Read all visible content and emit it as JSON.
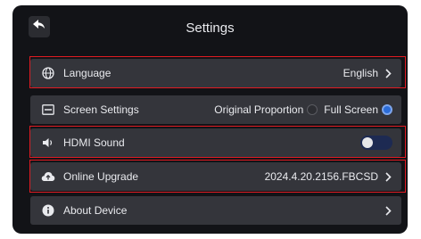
{
  "header": {
    "title": "Settings"
  },
  "rows": [
    {
      "label": "Language",
      "value": "English"
    },
    {
      "label": "Screen Settings",
      "option_a": "Original Proportion",
      "option_b": "Full Screen",
      "selected": "Full Screen"
    },
    {
      "label": "HDMI Sound",
      "toggle_state": "on"
    },
    {
      "label": "Online Upgrade",
      "value": "2024.4.20.2156.FBCSD"
    },
    {
      "label": "About Device"
    }
  ],
  "colors": {
    "accent": "#2b6cd8",
    "highlight": "#e01b22",
    "background": "#121317",
    "row": "#34353b"
  }
}
